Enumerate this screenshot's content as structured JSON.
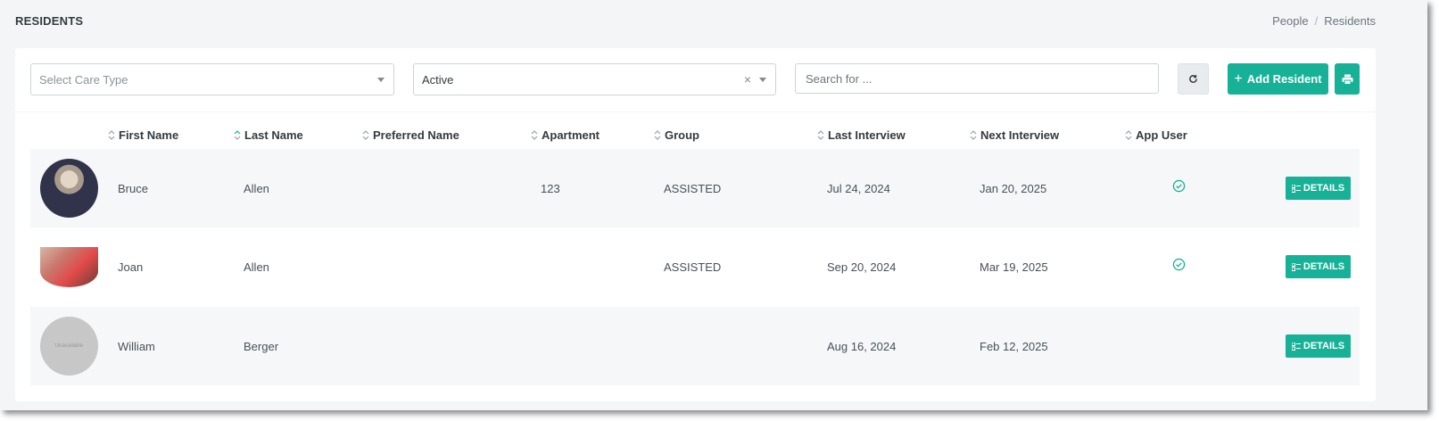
{
  "header": {
    "title": "RESIDENTS",
    "breadcrumb": [
      "People",
      "Residents"
    ],
    "breadcrumb_separator": "/"
  },
  "filters": {
    "care_type": {
      "placeholder": "Select Care Type",
      "value": ""
    },
    "status": {
      "value": "Active",
      "clear_icon": "×"
    },
    "search": {
      "placeholder": "Search for ...",
      "value": ""
    },
    "refresh_icon": "refresh-icon",
    "add_button": {
      "label": "Add Resident",
      "icon": "+"
    },
    "print_icon": "printer-icon"
  },
  "table": {
    "columns": [
      "First Name",
      "Last Name",
      "Preferred Name",
      "Apartment",
      "Group",
      "Last Interview",
      "Next Interview",
      "App User"
    ],
    "sorted_column": "Last Name",
    "rows": [
      {
        "first_name": "Bruce",
        "last_name": "Allen",
        "preferred_name": "",
        "apartment": "123",
        "group": "ASSISTED",
        "last_interview": "Jul 24, 2024",
        "next_interview": "Jan 20, 2025",
        "app_user": true,
        "details_label": "DETAILS"
      },
      {
        "first_name": "Joan",
        "last_name": "Allen",
        "preferred_name": "",
        "apartment": "",
        "group": "ASSISTED",
        "last_interview": "Sep 20, 2024",
        "next_interview": "Mar 19, 2025",
        "app_user": true,
        "details_label": "DETAILS"
      },
      {
        "first_name": "William",
        "last_name": "Berger",
        "preferred_name": "",
        "apartment": "",
        "group": "",
        "last_interview": "Aug 16, 2024",
        "next_interview": "Feb 12, 2025",
        "app_user": false,
        "details_label": "DETAILS",
        "avatar_text": "Unavailable"
      }
    ]
  },
  "colors": {
    "accent": "#16b196",
    "page_background": "#f4f5f7",
    "row_stripe": "#f6f7f9"
  }
}
